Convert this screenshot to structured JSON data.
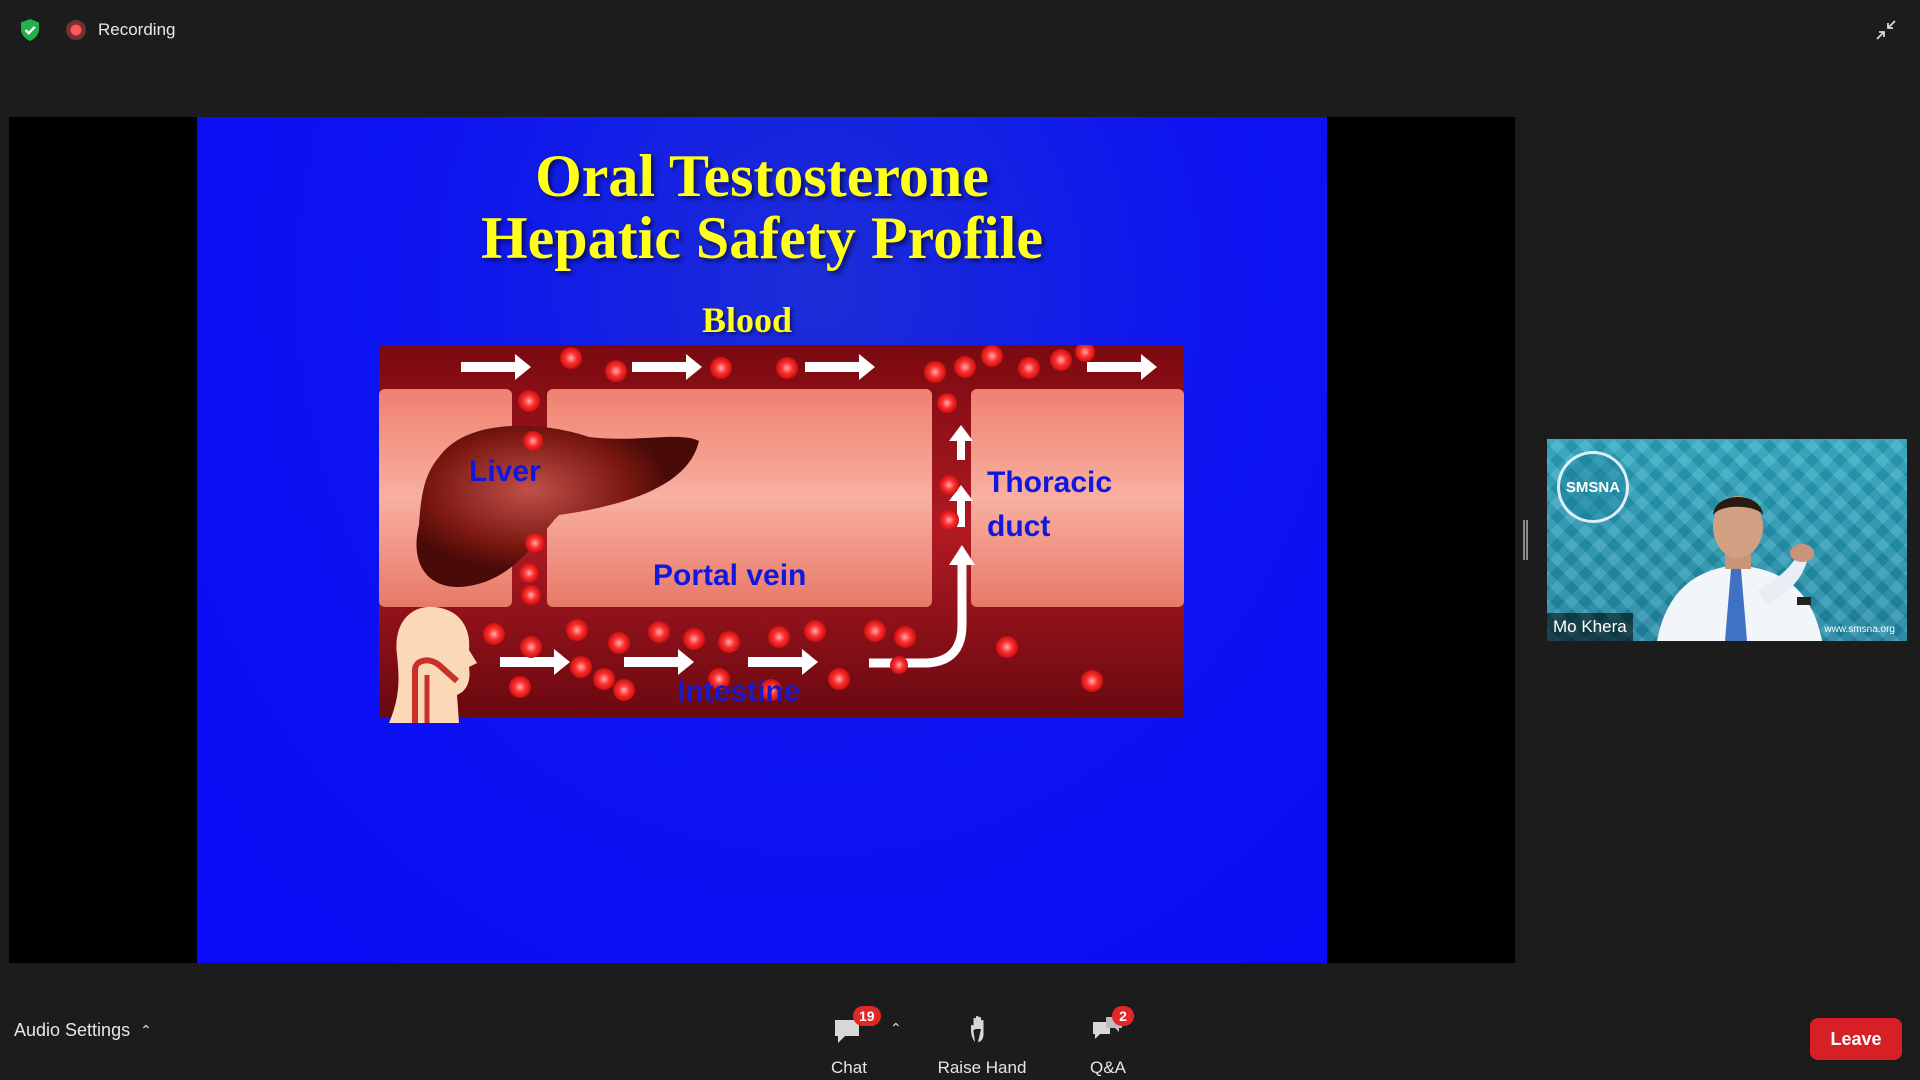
{
  "topbar": {
    "recording_label": "Recording",
    "icons": {
      "security": "shield-check-icon",
      "recording": "record-icon",
      "exit_fullscreen": "exit-fullscreen-icon"
    }
  },
  "slide": {
    "title_line1": "Oral Testosterone",
    "title_line2": "Hepatic Safety Profile",
    "blood_label": "Blood",
    "liver_label": "Liver",
    "portal_vein_label": "Portal vein",
    "thoracic_label_line1": "Thoracic",
    "thoracic_label_line2": "duct",
    "intestine_label": "Intestine",
    "colors": {
      "background": "#0a0af6",
      "title": "#ffff1a",
      "labels": "#1018e0"
    }
  },
  "participant": {
    "name": "Mo Khera",
    "org_logo_text": "SMSNA",
    "org_url": "www.smsna.org"
  },
  "bottombar": {
    "audio_settings_label": "Audio Settings",
    "chat": {
      "label": "Chat",
      "badge": "19",
      "icon": "chat-bubble-icon"
    },
    "raise_hand": {
      "label": "Raise Hand",
      "icon": "hand-icon"
    },
    "qa": {
      "label": "Q&A",
      "badge": "2",
      "icon": "qa-bubbles-icon"
    },
    "leave_label": "Leave",
    "colors": {
      "leave": "#d71f26",
      "badge": "#e02828"
    }
  }
}
